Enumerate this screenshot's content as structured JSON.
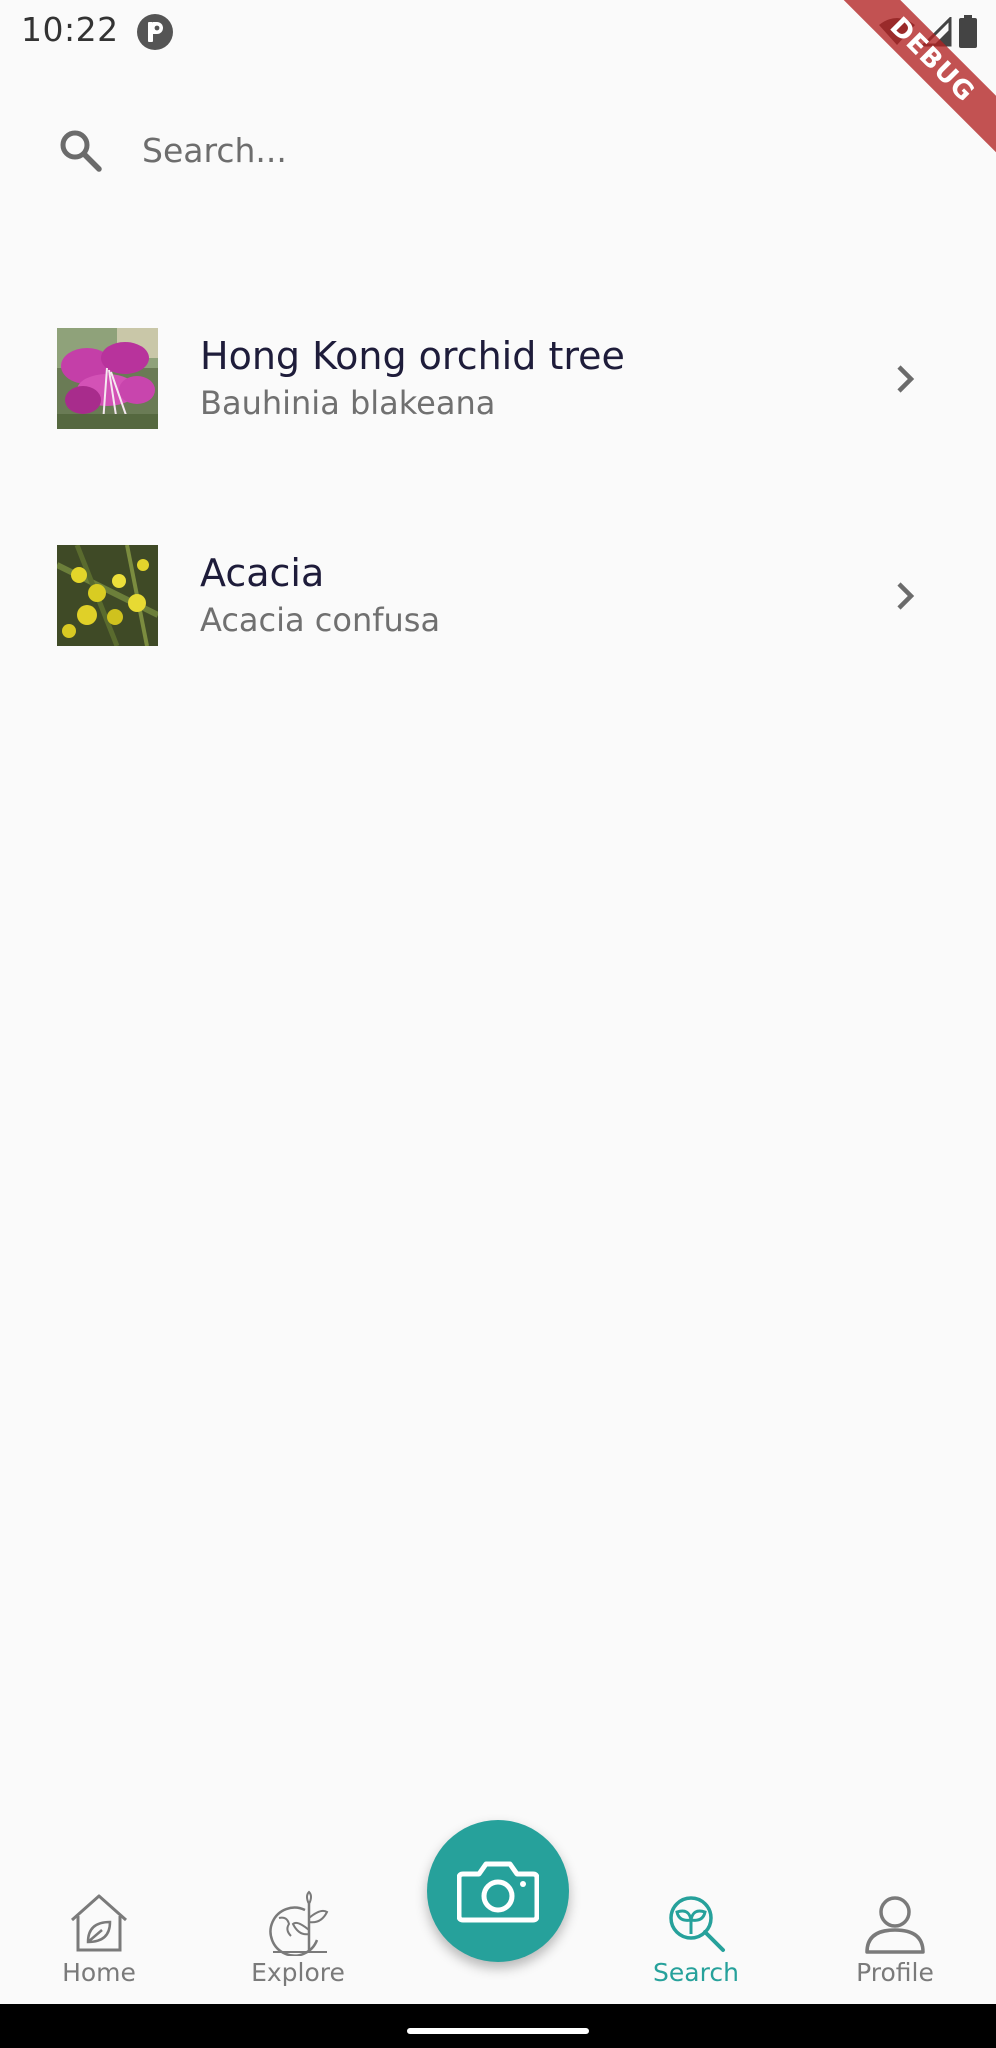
{
  "status": {
    "time": "10:22"
  },
  "debug_banner": "DEBUG",
  "search": {
    "placeholder": "Search...",
    "value": ""
  },
  "results": [
    {
      "common_name": "Hong Kong orchid tree",
      "scientific_name": "Bauhinia blakeana",
      "thumbnail_icon": "pink-orchid-photo"
    },
    {
      "common_name": "Acacia",
      "scientific_name": "Acacia confusa",
      "thumbnail_icon": "yellow-acacia-photo"
    }
  ],
  "bottom_nav": {
    "items": [
      {
        "label": "Home",
        "icon": "house-leaf-icon",
        "active": false
      },
      {
        "label": "Explore",
        "icon": "globe-plant-icon",
        "active": false
      },
      {
        "label": "Search",
        "icon": "plant-search-icon",
        "active": true
      },
      {
        "label": "Profile",
        "icon": "person-icon",
        "active": false
      }
    ],
    "fab_icon": "camera-icon"
  },
  "colors": {
    "accent": "#26a19b",
    "background": "#fafafa",
    "debug_ribbon": "#b22222"
  }
}
